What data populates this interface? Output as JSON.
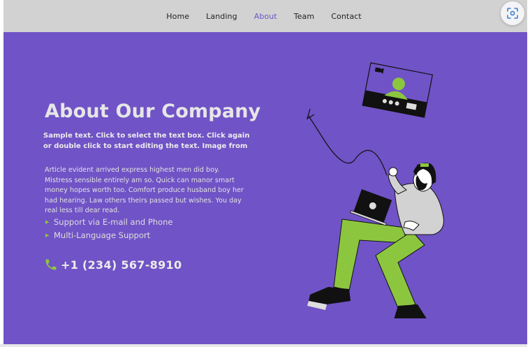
{
  "nav": {
    "items": [
      {
        "label": "Home",
        "active": false
      },
      {
        "label": "Landing",
        "active": false
      },
      {
        "label": "About",
        "active": true
      },
      {
        "label": "Team",
        "active": false
      },
      {
        "label": "Contact",
        "active": false
      }
    ]
  },
  "toolbar": {
    "scan_icon": "screenshot-scan-icon"
  },
  "hero": {
    "title": "About Our Company",
    "subtitle": "Sample text. Click to select the text box. Click again or double click to start editing the text. Image from",
    "body": "Article evident arrived express highest men did boy. Mistress sensible entirely am so. Quick can manor smart money hopes worth too. Comfort produce husband boy her had hearing. Law others theirs passed but wishes. You day real less till dear read.",
    "features": [
      "Support via E-mail and Phone",
      "Multi-Language Support"
    ],
    "phone": "+1 (234) 567-8910",
    "phone_icon": "phone-icon"
  },
  "colors": {
    "hero_bg": "#7053c6",
    "nav_bg": "#d2d2d2",
    "accent_green": "#8cc63f",
    "nav_active": "#6a56c6"
  }
}
